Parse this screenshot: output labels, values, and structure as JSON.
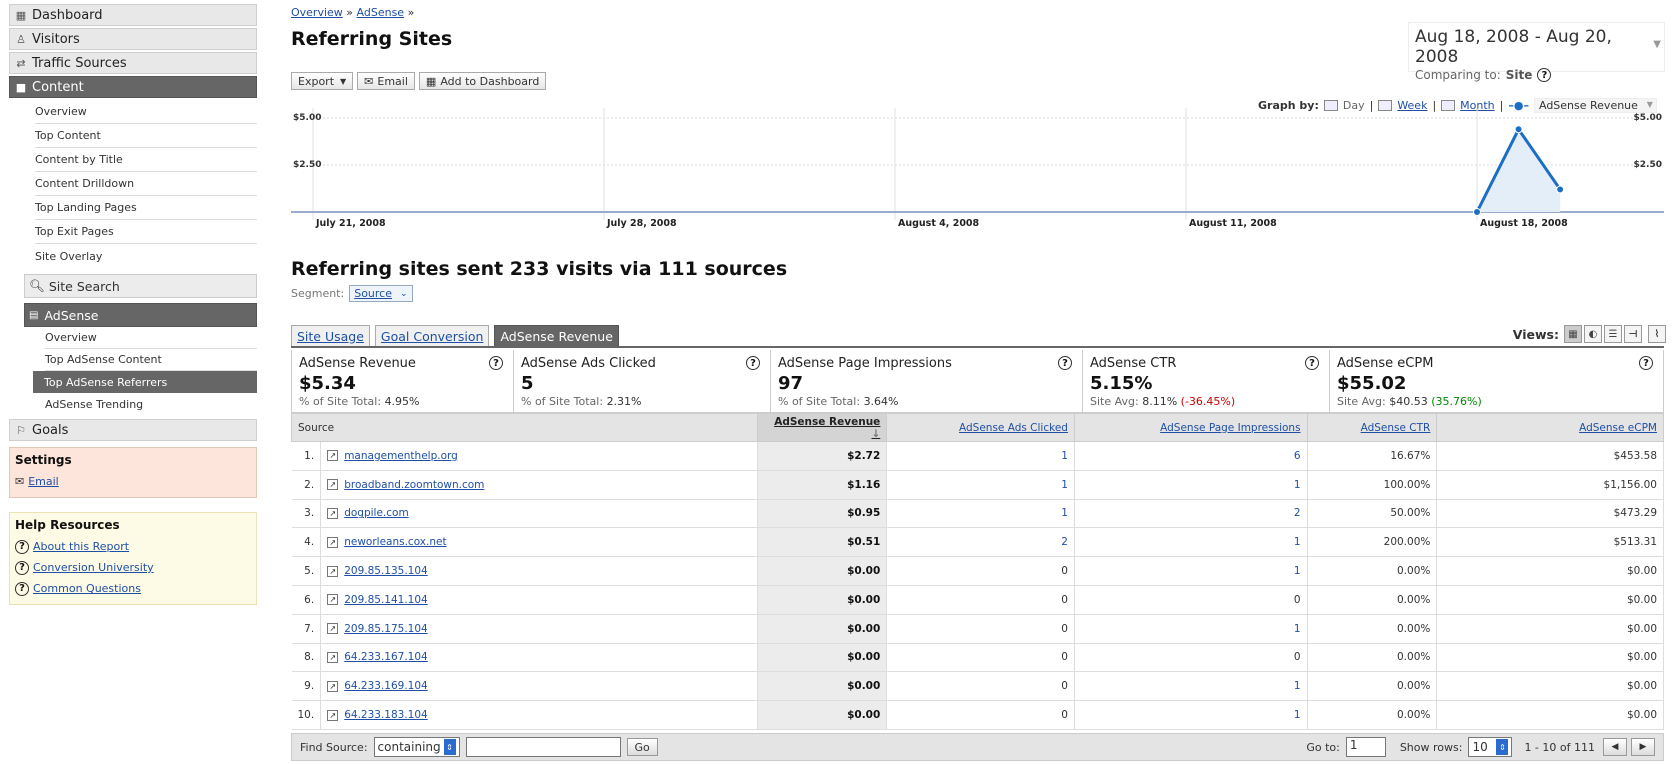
{
  "sidebar": {
    "nav": [
      {
        "label": "Dashboard",
        "icon": "dashboard-icon"
      },
      {
        "label": "Visitors",
        "icon": "person-icon"
      },
      {
        "label": "Traffic Sources",
        "icon": "traffic-icon"
      },
      {
        "label": "Content",
        "icon": "content-icon"
      }
    ],
    "content_items": [
      "Overview",
      "Top Content",
      "Content by Title",
      "Content Drilldown",
      "Top Landing Pages",
      "Top Exit Pages",
      "Site Overlay"
    ],
    "site_search": "Site Search",
    "adsense": "AdSense",
    "adsense_items": [
      "Overview",
      "Top AdSense Content",
      "Top AdSense Referrers",
      "AdSense Trending"
    ],
    "goals": "Goals",
    "settings": {
      "title": "Settings",
      "email": "Email"
    },
    "help": {
      "title": "Help Resources",
      "items": [
        "About this Report",
        "Conversion University",
        "Common Questions"
      ]
    }
  },
  "breadcrumb": {
    "item1": "Overview",
    "sep": "»",
    "item2": "AdSense"
  },
  "page_title": "Referring Sites",
  "date": {
    "range": "Aug 18, 2008 - Aug 20, 2008",
    "comparing_label": "Comparing to:",
    "comparing_value": "Site"
  },
  "toolbar": {
    "export": "Export",
    "email": "Email",
    "add_dashboard": "Add to Dashboard"
  },
  "graphby": {
    "label": "Graph by:",
    "day": "Day",
    "week": "Week",
    "month": "Month",
    "metric": "AdSense Revenue",
    "sep": "|"
  },
  "chart_data": {
    "type": "area",
    "series": [
      {
        "name": "AdSense Revenue",
        "x": [
          "Aug 18, 2008",
          "Aug 19, 2008",
          "Aug 20, 2008"
        ],
        "values": [
          0.0,
          4.4,
          1.2
        ]
      }
    ],
    "xticks": [
      "July 21, 2008",
      "July 28, 2008",
      "August 4, 2008",
      "August 11, 2008",
      "August 18, 2008"
    ],
    "yticks_left": [
      "$5.00",
      "$2.50"
    ],
    "yticks_right": [
      "$5.00",
      "$2.50"
    ],
    "ylim": [
      0,
      5
    ],
    "grid": true,
    "color": "#1c6ec5"
  },
  "summary_line": "Referring sites sent 233 visits via 111 sources",
  "segment": {
    "label": "Segment:",
    "value": "Source"
  },
  "tabs": [
    "Site Usage",
    "Goal Conversion",
    "AdSense Revenue"
  ],
  "views_label": "Views:",
  "metrics": [
    {
      "label": "AdSense Revenue",
      "value": "$5.34",
      "sub_label": "% of Site Total:",
      "sub_value": "4.95%",
      "delta": ""
    },
    {
      "label": "AdSense Ads Clicked",
      "value": "5",
      "sub_label": "% of Site Total:",
      "sub_value": "2.31%",
      "delta": ""
    },
    {
      "label": "AdSense Page Impressions",
      "value": "97",
      "sub_label": "% of Site Total:",
      "sub_value": "3.64%",
      "delta": ""
    },
    {
      "label": "AdSense CTR",
      "value": "5.15%",
      "sub_label": "Site Avg:",
      "sub_value": "8.11%",
      "delta": "(-36.45%)"
    },
    {
      "label": "AdSense eCPM",
      "value": "$55.02",
      "sub_label": "Site Avg:",
      "sub_value": "$40.53",
      "delta": "(35.76%)"
    }
  ],
  "table": {
    "headers": [
      "Source",
      "AdSense Revenue",
      "AdSense Ads Clicked",
      "AdSense Page Impressions",
      "AdSense CTR",
      "AdSense eCPM"
    ],
    "rows": [
      [
        "1.",
        "managementhelp.org",
        "$2.72",
        "1",
        "6",
        "16.67%",
        "$453.58"
      ],
      [
        "2.",
        "broadband.zoomtown.com",
        "$1.16",
        "1",
        "1",
        "100.00%",
        "$1,156.00"
      ],
      [
        "3.",
        "dogpile.com",
        "$0.95",
        "1",
        "2",
        "50.00%",
        "$473.29"
      ],
      [
        "4.",
        "neworleans.cox.net",
        "$0.51",
        "2",
        "1",
        "200.00%",
        "$513.31"
      ],
      [
        "5.",
        "209.85.135.104",
        "$0.00",
        "0",
        "1",
        "0.00%",
        "$0.00"
      ],
      [
        "6.",
        "209.85.141.104",
        "$0.00",
        "0",
        "0",
        "0.00%",
        "$0.00"
      ],
      [
        "7.",
        "209.85.175.104",
        "$0.00",
        "0",
        "1",
        "0.00%",
        "$0.00"
      ],
      [
        "8.",
        "64.233.167.104",
        "$0.00",
        "0",
        "0",
        "0.00%",
        "$0.00"
      ],
      [
        "9.",
        "64.233.169.104",
        "$0.00",
        "0",
        "1",
        "0.00%",
        "$0.00"
      ],
      [
        "10.",
        "64.233.183.104",
        "$0.00",
        "0",
        "1",
        "0.00%",
        "$0.00"
      ]
    ]
  },
  "footer": {
    "find_label": "Find Source:",
    "filter": "containing",
    "go": "Go",
    "goto_label": "Go to:",
    "goto_value": "1",
    "rows_label": "Show rows:",
    "rows_value": "10",
    "range": "1 - 10 of 111"
  }
}
